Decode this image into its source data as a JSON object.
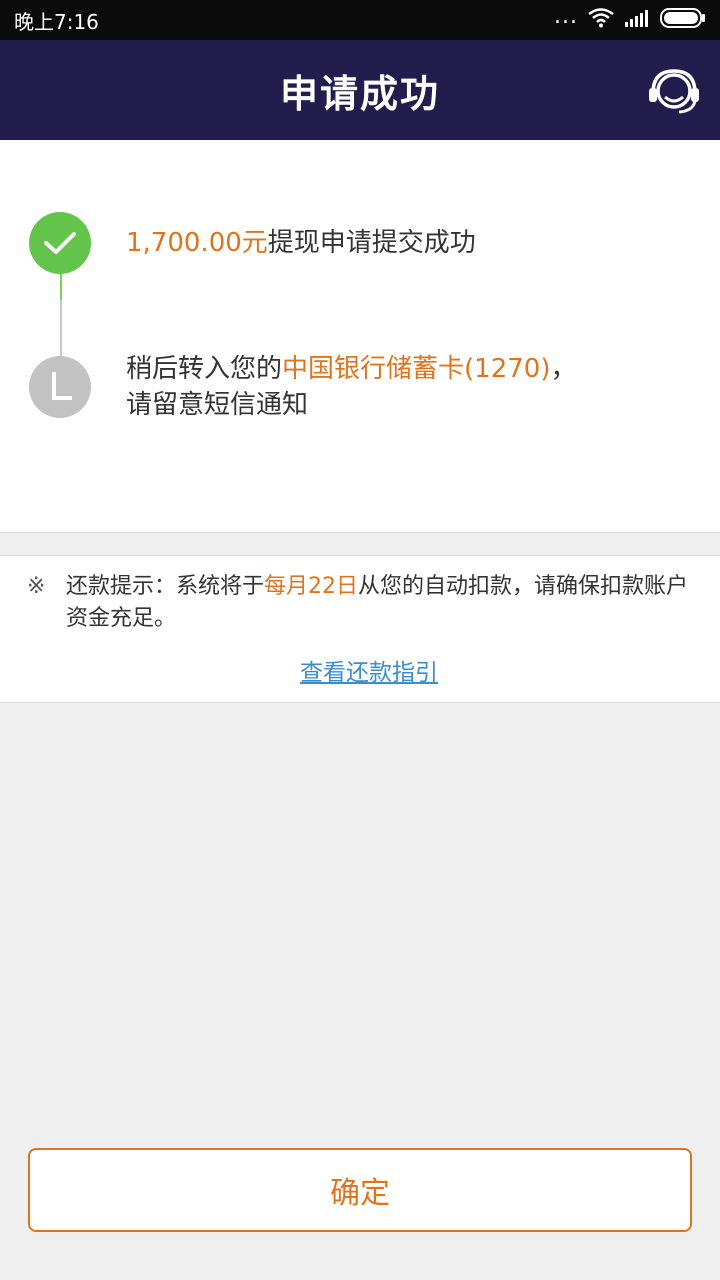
{
  "status_bar": {
    "time": "晚上7:16",
    "dots": "...",
    "icons": [
      "wifi-icon",
      "signal-icon",
      "battery-icon"
    ]
  },
  "header": {
    "title": "申请成功",
    "support_icon": "customer-service-headset-icon"
  },
  "steps": [
    {
      "state": "done",
      "icon": "check-icon",
      "amount": "1,700.00元",
      "text": "提现申请提交成功"
    },
    {
      "state": "pending",
      "icon": "clock-icon",
      "prefix": "稍后转入您的",
      "bank": "中国银行储蓄卡(1270)",
      "suffix": "，",
      "line2": "请留意短信通知"
    }
  ],
  "notice": {
    "mark": "※",
    "prefix": "还款提示：系统将于",
    "highlight": "每月22日",
    "suffix": "从您的自动扣款，请确保扣款账户资金充足。",
    "link": "查看还款指引"
  },
  "confirm_button": "确定",
  "colors": {
    "header_bg": "#221d4d",
    "accent_orange": "#e0741d",
    "success_green": "#62c44a",
    "pending_gray": "#c2c2c2",
    "link_blue": "#3a8ed0"
  }
}
